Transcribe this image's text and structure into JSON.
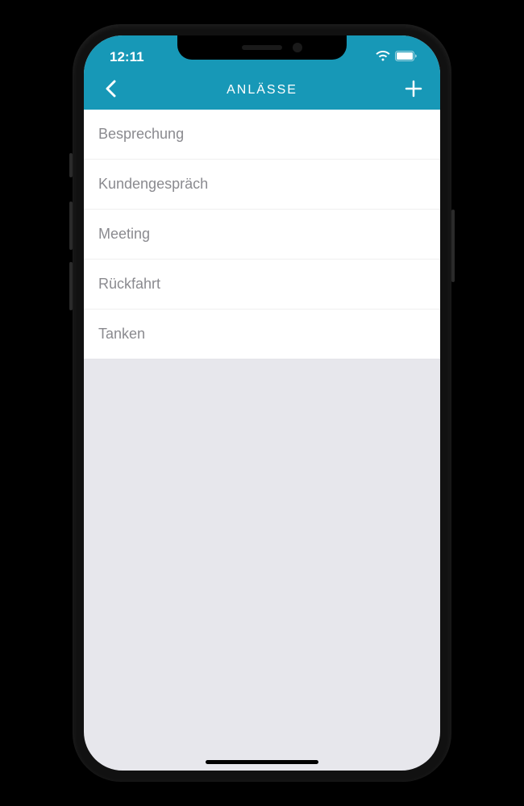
{
  "status": {
    "time": "12:11"
  },
  "nav": {
    "title": "ANLÄSSE"
  },
  "list": {
    "items": [
      {
        "label": "Besprechung"
      },
      {
        "label": "Kundengespräch"
      },
      {
        "label": "Meeting"
      },
      {
        "label": "Rückfahrt"
      },
      {
        "label": "Tanken"
      }
    ]
  }
}
